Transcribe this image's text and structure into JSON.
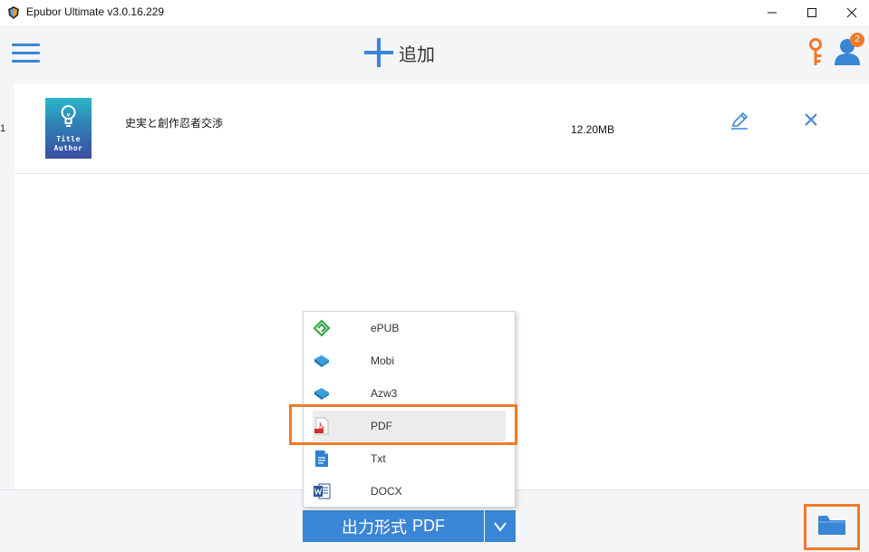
{
  "window": {
    "title": "Epubor Ultimate v3.0.16.229",
    "controls": [
      "minimize",
      "maximize",
      "close"
    ]
  },
  "toolbar": {
    "menu_icon": "hamburger-menu-icon",
    "add_label": "追加",
    "key_icon": "key-icon",
    "user_icon": "user-icon",
    "notification_count": "2"
  },
  "books": [
    {
      "index": "1",
      "cover_line1": "Title",
      "cover_line2": "Author",
      "title": "史実と創作忍者交渉",
      "size": "12.20MB"
    }
  ],
  "output": {
    "label": "出力形式",
    "format": "PDF",
    "dropdown_icon": "chevron-down-icon"
  },
  "format_menu": {
    "items": [
      {
        "label": "ePUB",
        "icon": "epub-icon"
      },
      {
        "label": "Mobi",
        "icon": "mobi-book-icon"
      },
      {
        "label": "Azw3",
        "icon": "azw3-book-icon"
      },
      {
        "label": "PDF",
        "icon": "pdf-icon",
        "selected": true
      },
      {
        "label": "Txt",
        "icon": "txt-file-icon"
      },
      {
        "label": "DOCX",
        "icon": "word-docx-icon"
      }
    ]
  },
  "colors": {
    "accent_blue": "#3a86d6",
    "highlight_orange": "#f07a28",
    "background": "#f4f5f7"
  }
}
